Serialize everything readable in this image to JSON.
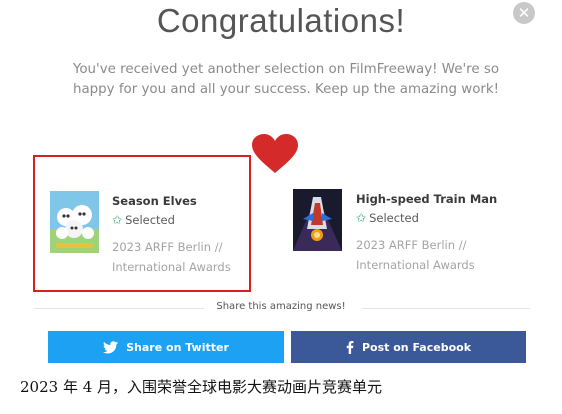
{
  "dialog": {
    "close_icon": "close-icon",
    "title": "Congratulations!",
    "message": "You've received yet another selection on FilmFreeway! We're so happy for you and all your success. Keep up the amazing work!",
    "heart_icon": "heart-icon",
    "heart_color": "#d42a2a"
  },
  "selections": [
    {
      "title": "Season Elves",
      "status": "Selected",
      "festival": "2023 ARFF Berlin // International Awards",
      "highlight_color": "#d22222"
    },
    {
      "title": "High-speed Train Man",
      "status": "Selected",
      "festival": "2023 ARFF Berlin // International Awards"
    }
  ],
  "share": {
    "label": "Share this amazing news!",
    "twitter_label": "Share on Twitter",
    "facebook_label": "Post on Facebook",
    "twitter_color": "#1da1f2",
    "facebook_color": "#3b5998"
  },
  "caption": "2023 年 4 月，入围荣誉全球电影大赛动画片竞赛单元"
}
